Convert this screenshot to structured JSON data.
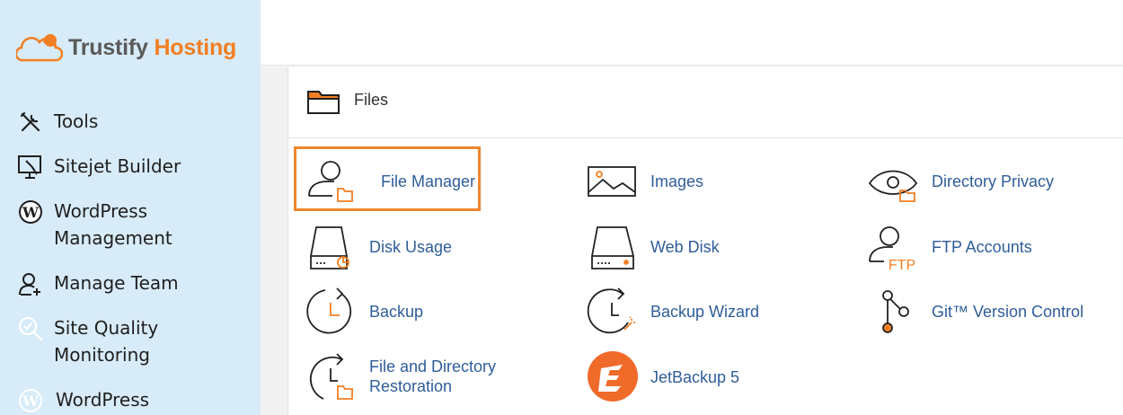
{
  "brand": {
    "name_part1": "Trustify",
    "name_part2": "Hosting",
    "logo_icon": "cloud-logo-icon",
    "colors": {
      "gray": "#5a5a5a",
      "orange": "#f27f23"
    }
  },
  "sidebar": {
    "background": "#d8ebf8",
    "items": [
      {
        "label": "Tools",
        "icon": "tools-icon"
      },
      {
        "label": "Sitejet Builder",
        "icon": "sitejet-icon"
      },
      {
        "label": "WordPress Management",
        "icon": "wordpress-icon"
      },
      {
        "label": "Manage Team",
        "icon": "team-icon"
      },
      {
        "label": "Site Quality Monitoring",
        "icon": "magnifier-check-icon"
      },
      {
        "label": "WordPress",
        "icon": "wordpress-icon"
      }
    ]
  },
  "section": {
    "title": "Files",
    "icon": "folder-icon"
  },
  "tools": [
    {
      "label": "File Manager",
      "icon": "file-manager-icon",
      "highlighted": true
    },
    {
      "label": "Images",
      "icon": "images-icon"
    },
    {
      "label": "Directory Privacy",
      "icon": "directory-privacy-icon"
    },
    {
      "label": "Disk Usage",
      "icon": "disk-usage-icon"
    },
    {
      "label": "Web Disk",
      "icon": "web-disk-icon"
    },
    {
      "label": "FTP Accounts",
      "icon": "ftp-accounts-icon",
      "icon_text": "FTP"
    },
    {
      "label": "Backup",
      "icon": "backup-icon"
    },
    {
      "label": "Backup Wizard",
      "icon": "backup-wizard-icon"
    },
    {
      "label": "Git™ Version Control",
      "icon": "git-icon"
    },
    {
      "label": "File and Directory Restoration",
      "icon": "restoration-icon"
    },
    {
      "label": "JetBackup 5",
      "icon": "jetbackup-icon"
    }
  ],
  "colors": {
    "accent": "#f0862c",
    "link": "#2f5d9a",
    "icon_stroke": "#222222"
  }
}
